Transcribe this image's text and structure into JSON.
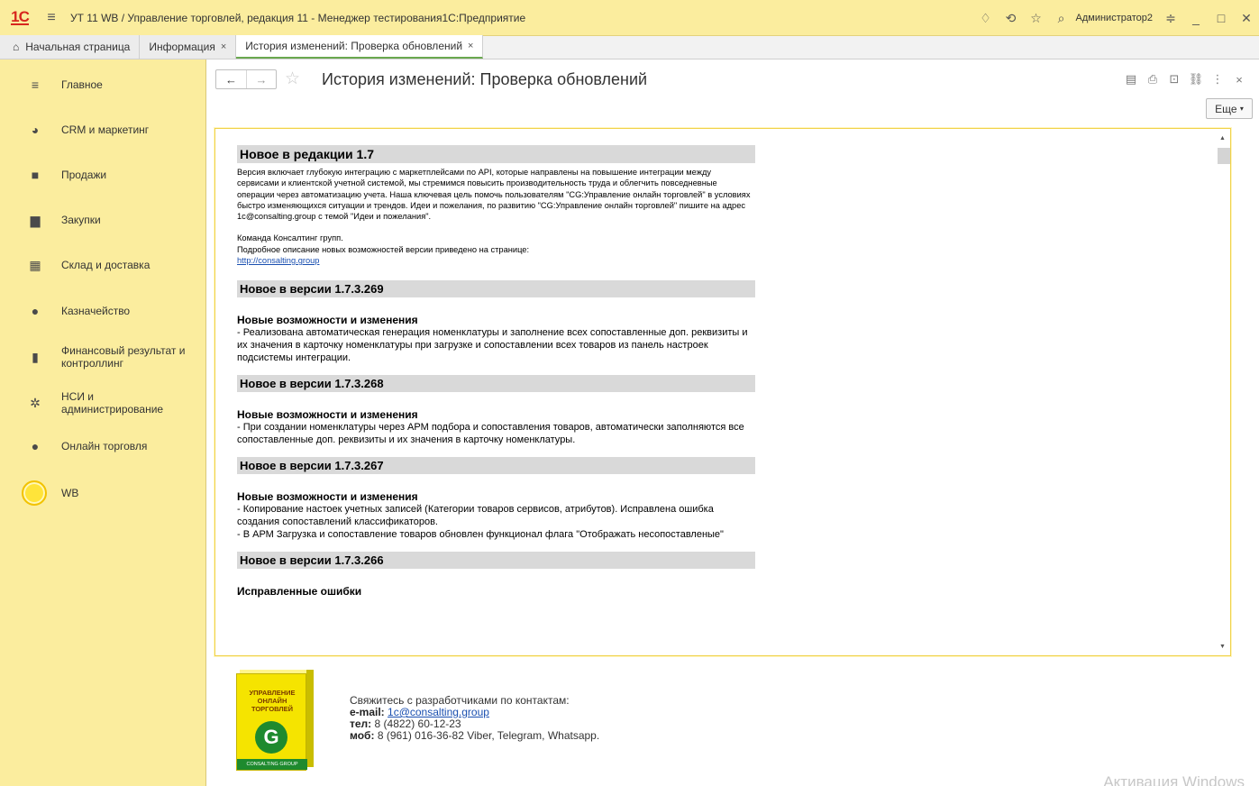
{
  "app": {
    "logo": "1С",
    "window_title": "УТ 11 WB / Управление торговлей, редакция 11  - Менеджер тестирования1С:Предприятие",
    "user": "Администратор2"
  },
  "tabs": [
    {
      "label": "Начальная страница"
    },
    {
      "label": "Информация",
      "close": "×"
    },
    {
      "label": "История изменений: Проверка обновлений",
      "close": "×"
    }
  ],
  "sidebar": {
    "items": [
      {
        "icon": "menu-icon",
        "label": "Главное"
      },
      {
        "icon": "pie-chart-icon",
        "label": "CRM и маркетинг"
      },
      {
        "icon": "bag-icon",
        "label": "Продажи"
      },
      {
        "icon": "cart-icon",
        "label": "Закупки"
      },
      {
        "icon": "warehouse-icon",
        "label": "Склад и доставка"
      },
      {
        "icon": "coin-icon",
        "label": "Казначейство"
      },
      {
        "icon": "bar-chart-icon",
        "label": "Финансовый результат и контроллинг"
      },
      {
        "icon": "gear-icon",
        "label": "НСИ и администрирование"
      },
      {
        "icon": "globe-icon",
        "label": "Онлайн торговля"
      },
      {
        "icon": "wb-circle-icon",
        "label": "WB"
      }
    ]
  },
  "page": {
    "title": "История изменений: Проверка обновлений",
    "more_button": "Еще"
  },
  "document": {
    "release": {
      "heading": "Новое в редакции 1.7",
      "paragraph": "Версия включает глубокую интеграцию с маркетплейсами по API, которые направлены на повышение интеграции между сервисами и клиентской учетной системой, мы стремимся повысить производительность труда и облегчить повседневные операции через автоматизацию учета. Наша ключевая цель помочь пользователям \"CG:Управление онлайн торговлей\" в условиях быстро изменяющихся ситуации и трендов. Идеи и пожелания, по развитию \"CG:Управление онлайн торговлей\" пишите на адрес 1c@consalting.group с темой \"Идеи и пожелания\".",
      "team": "Команда Консалтинг групп.",
      "details": "Подробное описание новых возможностей версии приведено на странице:",
      "link": "http://consalting.group"
    },
    "versions": [
      {
        "heading": "Новое в версии 1.7.3.269",
        "subheading": "Новые возможности и изменения",
        "lines": [
          "- Реализована автоматическая генерация номенклатуры и заполнение всех сопоставленные доп. реквизиты и их значения в карточку номенклатуры при загрузке и сопоставлении всех товаров из панель настроек подсистемы интеграции."
        ]
      },
      {
        "heading": "Новое в версии 1.7.3.268",
        "subheading": "Новые возможности и изменения",
        "lines": [
          "- При создании номенклатуры через АРМ подбора и сопоставления товаров, автоматически заполняются все сопоставленные доп. реквизиты и их значения в карточку номенклатуры."
        ]
      },
      {
        "heading": "Новое в версии 1.7.3.267",
        "subheading": "Новые возможности и изменения",
        "lines": [
          "- Копирование настоек учетных записей (Категории товаров сервисов, атрибутов). Исправлена ошибка создания сопоставлений классификаторов.",
          "- В АРМ Загрузка и сопоставление товаров обновлен функционал флага \"Отображать несопоставленые\""
        ]
      },
      {
        "heading": "Новое в версии 1.7.3.266",
        "subheading": "Исправленные ошибки",
        "lines": []
      }
    ]
  },
  "footer": {
    "box_text": "УПРАВЛЕНИЕ ОНЛАЙН ТОРГОВЛЕЙ",
    "box_brand": "CONSALTING GROUP",
    "intro": "Свяжитесь с разработчиками по контактам:",
    "email_label": "e-mail:",
    "email": "1c@consalting.group",
    "phone_label": "тел:",
    "phone": "8 (4822) 60-12-23",
    "mobile_label": "моб:",
    "mobile": "8 (961) 016-36-82 Viber, Telegram, Whatsapp."
  },
  "watermark": "Активация Windows"
}
